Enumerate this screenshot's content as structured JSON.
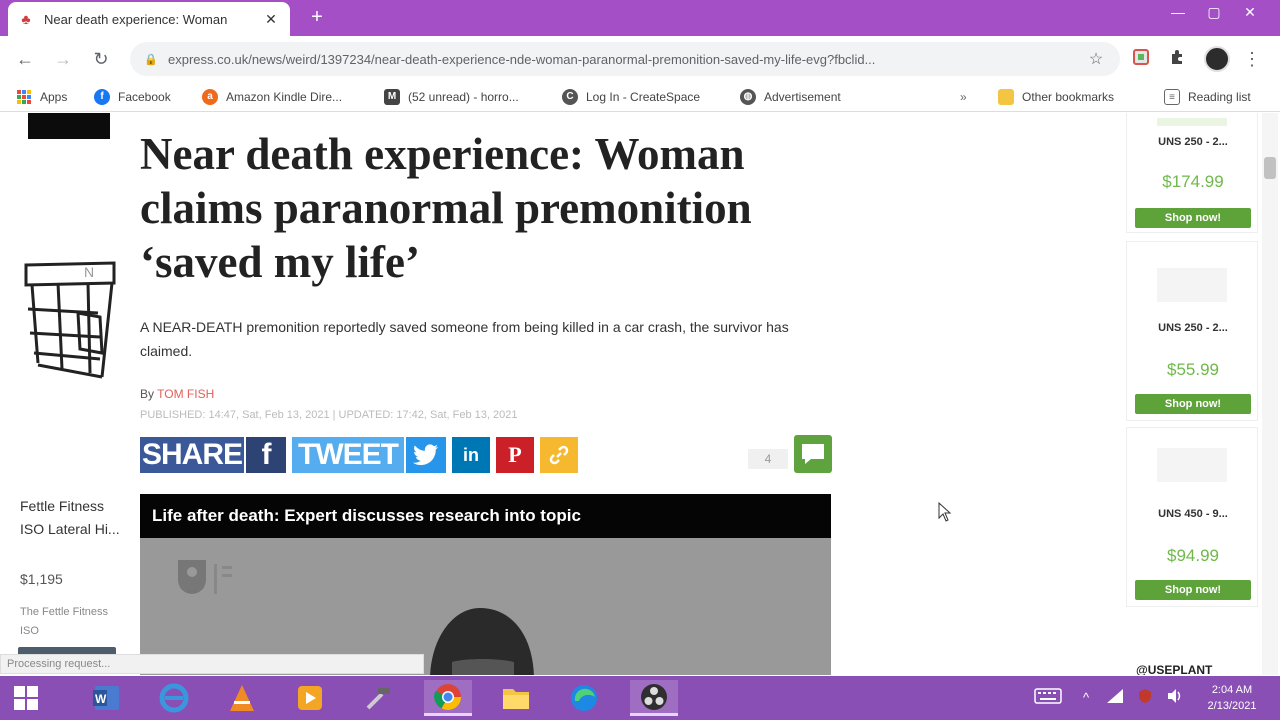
{
  "browser": {
    "tab_title": "Near death experience: Woman",
    "tab_close": "✕",
    "new_tab": "+",
    "window_controls": [
      "—",
      "▢",
      "✕"
    ],
    "url": "express.co.uk/news/weird/1397234/near-death-experience-nde-woman-paranormal-premonition-saved-my-life-evg?fbclid...",
    "accent_color": "#a44fc6"
  },
  "toolbar": {
    "back": "←",
    "forward": "→",
    "reload": "↻",
    "lock": "🔒",
    "star": "☆",
    "menu": "⋮"
  },
  "bookmarks": [
    {
      "label": "Apps",
      "icon": "apps-grid-icon",
      "color": "#4285f4"
    },
    {
      "label": "Facebook",
      "icon": "facebook-icon",
      "color": "#1877f2"
    },
    {
      "label": "Amazon Kindle Dire...",
      "icon": "amazon-icon",
      "color": "#f06a1d"
    },
    {
      "label": "(52 unread) - horro...",
      "icon": "mail-icon",
      "color": "#444444"
    },
    {
      "label": "Log In - CreateSpace",
      "icon": "createspace-icon",
      "color": "#555555"
    },
    {
      "label": "Advertisement",
      "icon": "globe-icon",
      "color": "#555555"
    },
    {
      "label": "Other bookmarks",
      "icon": "folder-icon",
      "color": "#f4c542"
    },
    {
      "label": "Reading list",
      "icon": "reading-list-icon",
      "color": "#666666"
    }
  ],
  "bookmarks_overflow": "»",
  "left_ad": {
    "name": "Fettle Fitness ISO Lateral Hi...",
    "price": "$1,195",
    "desc": "The Fettle Fitness ISO"
  },
  "article": {
    "headline": "Near death experience: Woman claims paranormal premonition ‘saved my life’",
    "standfirst": "A NEAR-DEATH premonition reportedly saved someone from being killed in a car crash, the survivor has claimed.",
    "byline_prefix": "By ",
    "author": "TOM FISH",
    "published": "PUBLISHED: 14:47, Sat, Feb 13, 2021 | UPDATED: 17:42, Sat, Feb 13, 2021",
    "share_label": "SHARE",
    "tweet_label": "TWEET",
    "facebook_glyph": "f",
    "linkedin_glyph": "in",
    "pinterest_glyph": "P",
    "comment_count": "4",
    "video_title": "Life after death: Expert discusses research into topic"
  },
  "share_colors": {
    "share": "#3b5998",
    "tweet": "#55acee",
    "linkedin": "#0077b5",
    "pinterest": "#cb2027",
    "link": "#f5b82e",
    "comment": "#5fa33e"
  },
  "products": [
    {
      "name": "UNS 250 - 2...",
      "price": "$174.99",
      "button": "Shop now!"
    },
    {
      "name": "UNS 250 - 2...",
      "price": "$55.99",
      "button": "Shop now!"
    },
    {
      "name": "UNS 450 - 9...",
      "price": "$94.99",
      "button": "Shop now!"
    }
  ],
  "rail_footer": "@USEPLANT",
  "status_text": "Processing request...",
  "taskbar": {
    "apps": [
      "start-icon",
      "word-icon",
      "edge-legacy-icon",
      "vlc-icon",
      "media-player-icon",
      "tools-icon",
      "chrome-icon",
      "file-explorer-icon",
      "edge-icon",
      "obs-icon"
    ],
    "tray_up": "^",
    "clock_time": "2:04 AM",
    "clock_date": "2/13/2021"
  }
}
